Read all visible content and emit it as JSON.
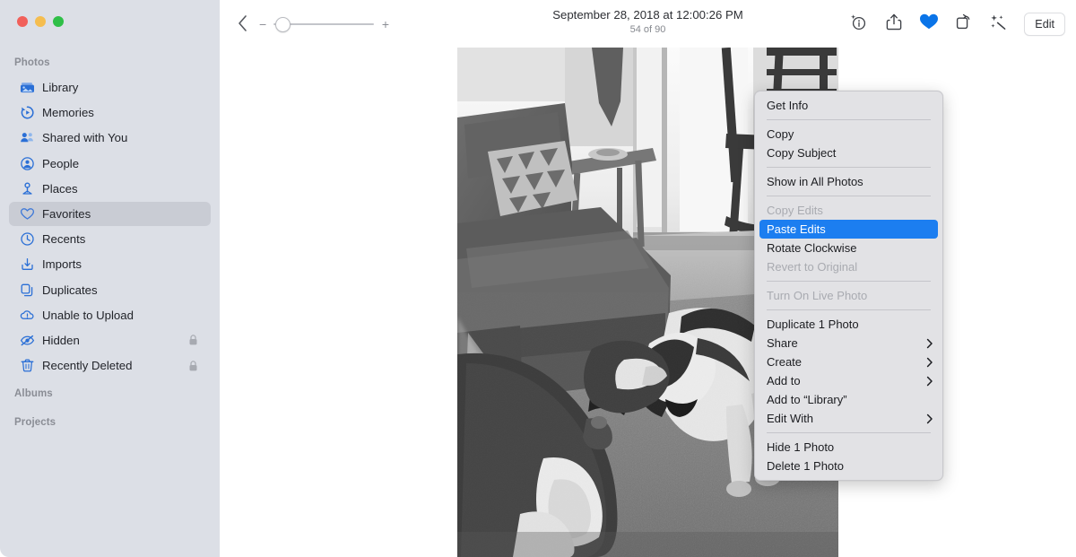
{
  "window": {
    "traffic_lights": [
      {
        "name": "close",
        "color": "#f1605a"
      },
      {
        "name": "minimize",
        "color": "#f5bd4f"
      },
      {
        "name": "zoom",
        "color": "#2fbf47"
      }
    ]
  },
  "sidebar": {
    "sections": [
      {
        "title": "Photos",
        "key": "photos"
      },
      {
        "title": "Albums",
        "key": "albums"
      },
      {
        "title": "Projects",
        "key": "projects"
      }
    ],
    "items": [
      {
        "label": "Library",
        "icon": "library-icon",
        "selected": false,
        "locked": false
      },
      {
        "label": "Memories",
        "icon": "memories-icon",
        "selected": false,
        "locked": false
      },
      {
        "label": "Shared with You",
        "icon": "shared-with-you-icon",
        "selected": false,
        "locked": false
      },
      {
        "label": "People",
        "icon": "people-icon",
        "selected": false,
        "locked": false
      },
      {
        "label": "Places",
        "icon": "places-icon",
        "selected": false,
        "locked": false
      },
      {
        "label": "Favorites",
        "icon": "heart-icon",
        "selected": true,
        "locked": false
      },
      {
        "label": "Recents",
        "icon": "clock-icon",
        "selected": false,
        "locked": false
      },
      {
        "label": "Imports",
        "icon": "import-icon",
        "selected": false,
        "locked": false
      },
      {
        "label": "Duplicates",
        "icon": "duplicates-icon",
        "selected": false,
        "locked": false
      },
      {
        "label": "Unable to Upload",
        "icon": "cloud-warning-icon",
        "selected": false,
        "locked": false
      },
      {
        "label": "Hidden",
        "icon": "eye-slash-icon",
        "selected": false,
        "locked": true
      },
      {
        "label": "Recently Deleted",
        "icon": "trash-icon",
        "selected": false,
        "locked": true
      }
    ]
  },
  "toolbar": {
    "back_icon": "chevron-left-icon",
    "zoom": {
      "minus": "−",
      "plus": "+",
      "value_percent": 12
    },
    "title": "September 28, 2018 at 12:00:26 PM",
    "subtitle": "54 of 90",
    "actions": [
      {
        "name": "info-button",
        "icon": "info-sparkle-icon",
        "active": false
      },
      {
        "name": "share-button",
        "icon": "share-icon",
        "active": false
      },
      {
        "name": "favorite-button",
        "icon": "heart-filled-icon",
        "active": true,
        "color": "#0a74e8"
      },
      {
        "name": "rotate-button",
        "icon": "rotate-icon",
        "active": false
      },
      {
        "name": "enhance-button",
        "icon": "magic-wand-icon",
        "active": false
      }
    ],
    "edit_label": "Edit"
  },
  "photo": {
    "alt": "Black and white photo of two dogs on a carpet next to a sectional sofa in a living room",
    "grayscale": true
  },
  "context_menu": {
    "highlight_color": "#1c7ef0",
    "groups": [
      [
        {
          "label": "Get Info",
          "disabled": false,
          "highlighted": false,
          "submenu": false
        }
      ],
      [
        {
          "label": "Copy",
          "disabled": false,
          "highlighted": false,
          "submenu": false
        },
        {
          "label": "Copy Subject",
          "disabled": false,
          "highlighted": false,
          "submenu": false
        }
      ],
      [
        {
          "label": "Show in All Photos",
          "disabled": false,
          "highlighted": false,
          "submenu": false
        }
      ],
      [
        {
          "label": "Copy Edits",
          "disabled": true,
          "highlighted": false,
          "submenu": false
        },
        {
          "label": "Paste Edits",
          "disabled": false,
          "highlighted": true,
          "submenu": false
        },
        {
          "label": "Rotate Clockwise",
          "disabled": false,
          "highlighted": false,
          "submenu": false
        },
        {
          "label": "Revert to Original",
          "disabled": true,
          "highlighted": false,
          "submenu": false
        }
      ],
      [
        {
          "label": "Turn On Live Photo",
          "disabled": true,
          "highlighted": false,
          "submenu": false
        }
      ],
      [
        {
          "label": "Duplicate 1 Photo",
          "disabled": false,
          "highlighted": false,
          "submenu": false
        },
        {
          "label": "Share",
          "disabled": false,
          "highlighted": false,
          "submenu": true
        },
        {
          "label": "Create",
          "disabled": false,
          "highlighted": false,
          "submenu": true
        },
        {
          "label": "Add to",
          "disabled": false,
          "highlighted": false,
          "submenu": true
        },
        {
          "label": "Add to “Library”",
          "disabled": false,
          "highlighted": false,
          "submenu": false
        },
        {
          "label": "Edit With",
          "disabled": false,
          "highlighted": false,
          "submenu": true
        }
      ],
      [
        {
          "label": "Hide 1 Photo",
          "disabled": false,
          "highlighted": false,
          "submenu": false
        },
        {
          "label": "Delete 1 Photo",
          "disabled": false,
          "highlighted": false,
          "submenu": false
        }
      ]
    ]
  }
}
